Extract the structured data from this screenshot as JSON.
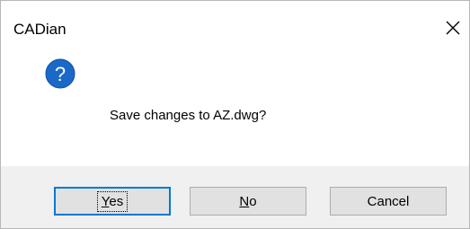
{
  "dialog": {
    "title": "CADian",
    "message": "Save changes to AZ.dwg?",
    "icon": "question-icon",
    "accent_color": "#0078d7",
    "buttons": [
      {
        "label_mnemonic": "Y",
        "label_rest": "es"
      },
      {
        "label_mnemonic": "N",
        "label_rest": "o"
      },
      {
        "label": "Cancel"
      }
    ]
  }
}
